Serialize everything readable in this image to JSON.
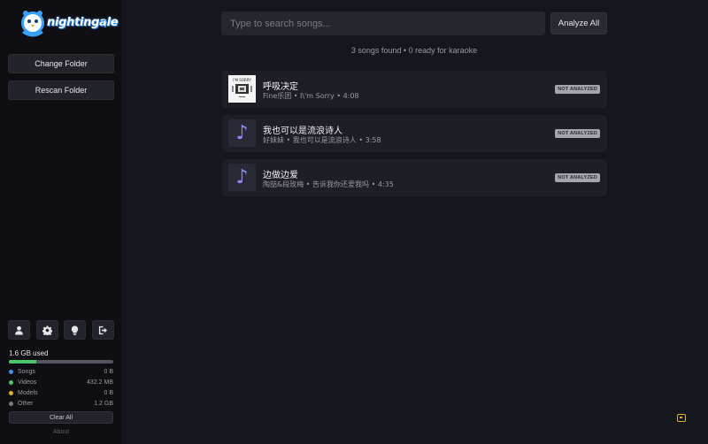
{
  "app": {
    "logo_text": "nightingale"
  },
  "sidebar": {
    "change_folder": "Change Folder",
    "rescan_folder": "Rescan Folder",
    "icons": [
      "user-icon",
      "gear-icon",
      "lightbulb-icon",
      "logout-icon"
    ],
    "storage": {
      "used": "1.6 GB used",
      "fill_fraction": 0.26,
      "items": [
        {
          "label": "Songs",
          "value": "0 B",
          "color": "#4a8cf0"
        },
        {
          "label": "Videos",
          "value": "432.2 MB",
          "color": "#4cc46a"
        },
        {
          "label": "Models",
          "value": "0 B",
          "color": "#e0b030"
        },
        {
          "label": "Other",
          "value": "1.2 GB",
          "color": "#7a7a85"
        }
      ],
      "clear_all": "Clear All"
    },
    "about": "About"
  },
  "main": {
    "search_placeholder": "Type to search songs...",
    "analyze_all": "Analyze All",
    "status": "3 songs found  •  0 ready for karaoke",
    "songs": [
      {
        "title": "呼吸决定",
        "meta": "Fine乐团  •  I\\'m Sorry  •  4:08",
        "badge": "NOT ANALYZED"
      },
      {
        "title": "我也可以是流浪诗人",
        "meta": "好妹妹  •  我也可以是流浪诗人  •  3:58",
        "badge": "NOT ANALYZED"
      },
      {
        "title": "边做边爱",
        "meta": "陶喆&段玫梅  •  告诉我你还爱我吗  •  4:35",
        "badge": "NOT ANALYZED"
      }
    ],
    "album_art_text": "I'M SORRY"
  }
}
